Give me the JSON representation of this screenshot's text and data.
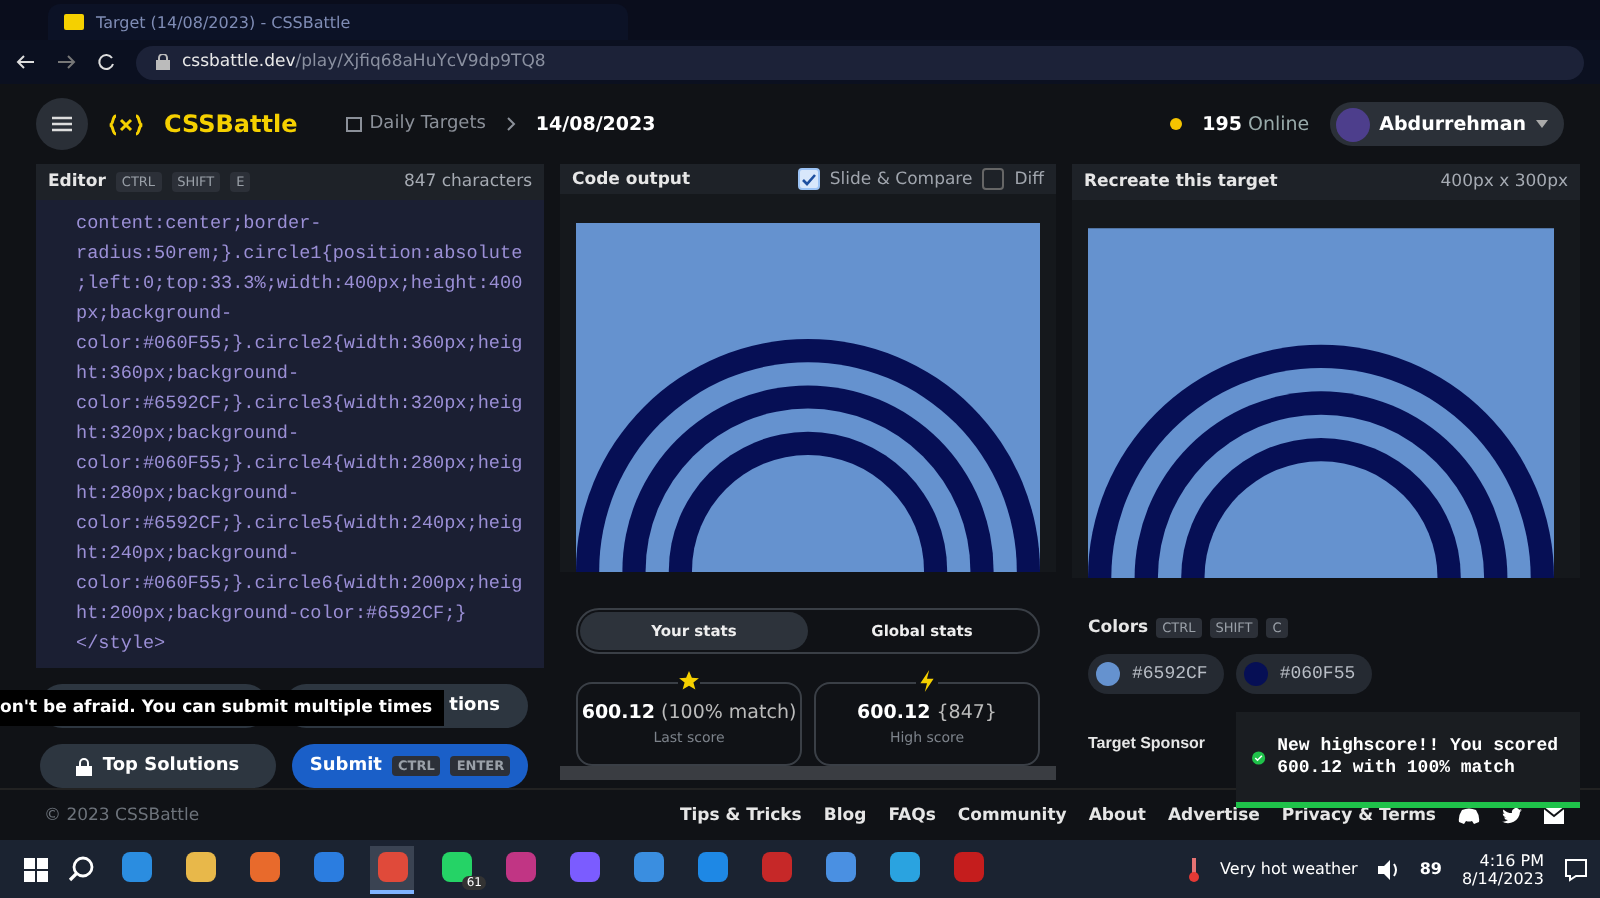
{
  "browser": {
    "tab_title": "Target (14/08/2023) - CSSBattle",
    "url_host": "cssbattle.dev",
    "url_path": "/play/Xjfiq68aHuYcV9dp9TQ8"
  },
  "header": {
    "logo": "CSSBattle",
    "breadcrumb": "Daily Targets",
    "date": "14/08/2023",
    "online_count": "195",
    "online_label": "Online",
    "user": "Abdurrehman"
  },
  "editor": {
    "title": "Editor",
    "shortcut": [
      "CTRL",
      "SHIFT",
      "E"
    ],
    "count": "847 characters",
    "lines": [
      "content:center;border-",
      "radius:50rem;}.circle1{position:absolute",
      ";left:0;top:33.3%;width:400px;height:400",
      "px;background-",
      "color:#060F55;}.circle2{width:360px;heig",
      "ht:360px;background-",
      "color:#6592CF;}.circle3{width:320px;heig",
      "ht:320px;background-",
      "color:#060F55;}.circle4{width:280px;heig",
      "ht:280px;background-",
      "color:#6592CF;}.circle5{width:240px;heig",
      "ht:240px;background-",
      "color:#060F55;}.circle6{width:200px;heig",
      "ht:200px;background-color:#6592CF;}",
      "</style>"
    ]
  },
  "tooltip": "on't be afraid. You can submit multiple times",
  "actions": {
    "hidden_button": "tions",
    "top_solutions": "Top Solutions",
    "submit": "Submit",
    "submit_shortcut": [
      "CTRL",
      "ENTER"
    ]
  },
  "output": {
    "title": "Code output",
    "options": [
      {
        "label": "Slide & Compare",
        "checked": true
      },
      {
        "label": "Diff",
        "checked": false
      }
    ],
    "stats_tabs": [
      {
        "label": "Your stats",
        "selected": true
      },
      {
        "label": "Global stats",
        "selected": false
      }
    ],
    "cards": [
      {
        "kind": "star",
        "score": "600.12",
        "detail": "(100% match)",
        "label": "Last score"
      },
      {
        "kind": "bolt",
        "score": "600.12",
        "detail": "{847}",
        "label": "High score"
      }
    ]
  },
  "target": {
    "title": "Recreate this target",
    "size": "400px x 300px",
    "colors_title": "Colors",
    "shortcut": [
      "CTRL",
      "SHIFT",
      "C"
    ],
    "colors": [
      {
        "label": "#6592CF",
        "color": "#6592cf"
      },
      {
        "label": "#060F55",
        "color": "#060f55"
      }
    ],
    "sponsor_title": "Target Sponsor"
  },
  "toast": {
    "message": "New highscore!! You scored 600.12 with 100% match"
  },
  "footer": {
    "copyright": "© 2023 CSSBattle",
    "links": [
      "Tips & Tricks",
      "Blog",
      "FAQs",
      "Community",
      "About",
      "Advertise",
      "Privacy & Terms"
    ]
  },
  "taskbar": {
    "apps": [
      {
        "selected": false
      },
      {
        "selected": false
      },
      {
        "selected": false
      },
      {
        "selected": false
      },
      {
        "selected": true
      },
      {
        "selected": false,
        "badge": "61"
      },
      {
        "selected": false
      },
      {
        "selected": false
      },
      {
        "selected": false
      },
      {
        "selected": false
      },
      {
        "selected": false
      },
      {
        "selected": false
      },
      {
        "selected": false
      },
      {
        "selected": false
      }
    ],
    "weather": "Very hot weather",
    "volume": "89",
    "time": "4:16 PM",
    "date": "8/14/2023"
  }
}
